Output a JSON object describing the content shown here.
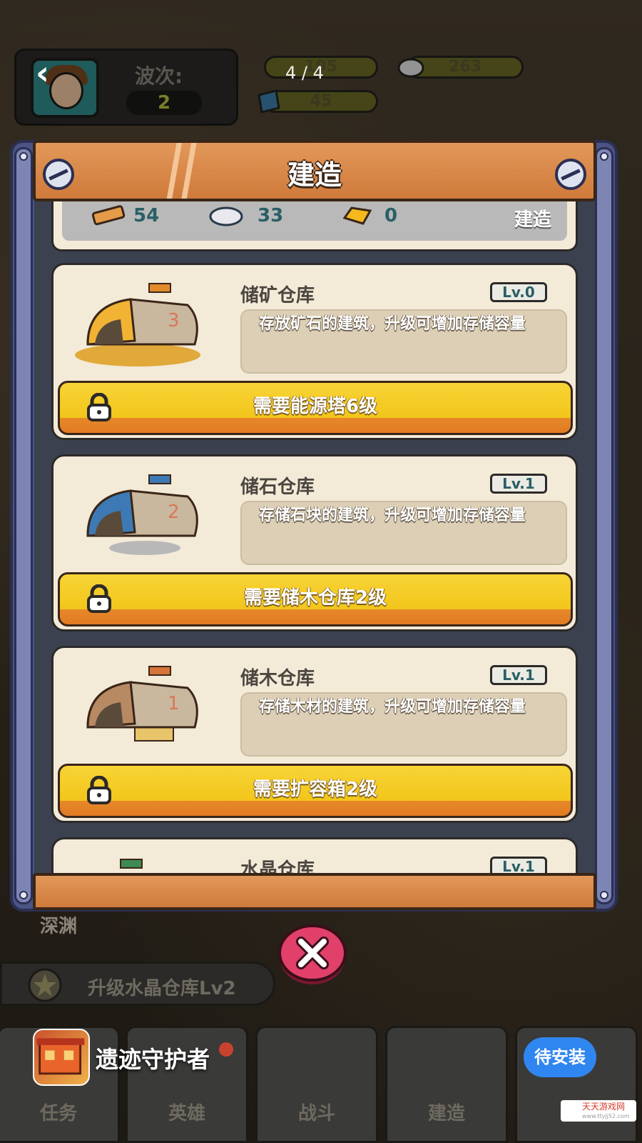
{
  "hud": {
    "wave_label": "波次:",
    "wave_value": "2",
    "resources": [
      "195",
      "263",
      "45"
    ],
    "pager": "4 / 4"
  },
  "modal": {
    "title": "建造",
    "summary": {
      "wood": "54",
      "stone": "33",
      "gold": "0",
      "build_label": "建造"
    },
    "cards": [
      {
        "name": "储矿仓库",
        "level": "Lv.0",
        "desc": "存放矿石的建筑，升级可增加存储容量",
        "requirement": "需要能源塔6级",
        "accent": "#f2b233"
      },
      {
        "name": "储石仓库",
        "level": "Lv.1",
        "desc": "存储石块的建筑，升级可增加存储容量",
        "requirement": "需要储木仓库2级",
        "accent": "#3d7ab5"
      },
      {
        "name": "储木仓库",
        "level": "Lv.1",
        "desc": "存储木材的建筑，升级可增加存储容量",
        "requirement": "需要扩容箱2级",
        "accent": "#d7743a"
      },
      {
        "name": "水晶仓库",
        "level": "Lv.1",
        "accent": "#3e8a52"
      }
    ]
  },
  "background": {
    "abyss_label": "深渊",
    "quest_text": "升级水晶仓库Lv2"
  },
  "nav": {
    "tabs": [
      "任务",
      "英雄",
      "战斗",
      "建造",
      ""
    ]
  },
  "ad": {
    "app_name": "遗迹守护者",
    "install_label": "待安装",
    "watermark": "天天游戏网",
    "watermark_url": "www.ttyjj52.com"
  }
}
